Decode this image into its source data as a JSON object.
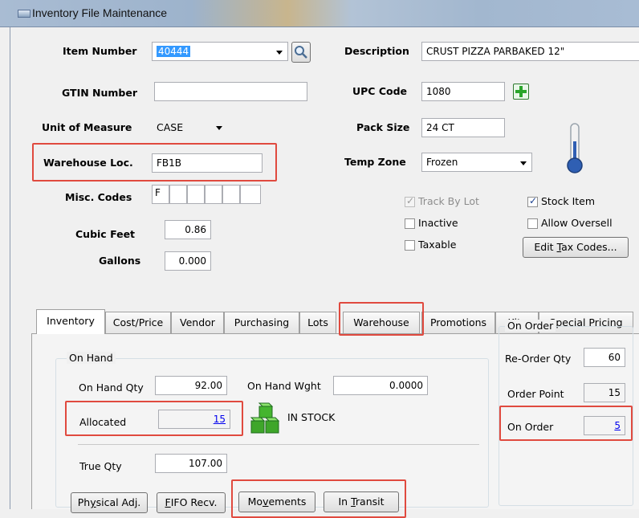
{
  "window": {
    "title": "Inventory File Maintenance"
  },
  "header": {
    "item_number": {
      "label": "Item Number",
      "value": "40444"
    },
    "gtin_number": {
      "label": "GTIN Number",
      "value": ""
    },
    "unit_of_measure": {
      "label": "Unit of Measure",
      "value": "CASE"
    },
    "warehouse_loc": {
      "label": "Warehouse Loc.",
      "value": "FB1B"
    },
    "misc_codes": {
      "label": "Misc. Codes",
      "values": [
        "F",
        "",
        "",
        "",
        "",
        ""
      ]
    },
    "cubic_feet": {
      "label": "Cubic Feet",
      "value": "0.86"
    },
    "gallons": {
      "label": "Gallons",
      "value": "0.000"
    },
    "description": {
      "label": "Description",
      "value": "CRUST PIZZA PARBAKED 12\""
    },
    "upc_code": {
      "label": "UPC Code",
      "value": "1080"
    },
    "pack_size": {
      "label": "Pack Size",
      "value": "24 CT"
    },
    "temp_zone": {
      "label": "Temp Zone",
      "value": "Frozen"
    }
  },
  "checkboxes": {
    "track_by_lot": {
      "label": "Track By Lot",
      "checked": true,
      "enabled": false
    },
    "stock_item": {
      "label": "Stock Item",
      "checked": true
    },
    "inactive": {
      "label": "Inactive",
      "checked": false
    },
    "allow_oversell": {
      "label": "Allow Oversell",
      "checked": false
    },
    "taxable": {
      "label": "Taxable",
      "checked": false
    }
  },
  "buttons": {
    "edit_tax_codes": {
      "pre": "Edit ",
      "accel": "T",
      "post": "ax Codes..."
    },
    "physical_adj": {
      "pre": "Ph",
      "accel": "y",
      "post": "sical Adj."
    },
    "fifo_recv": {
      "pre": "",
      "accel": "F",
      "post": "IFO Recv."
    },
    "movements": {
      "pre": "Mo",
      "accel": "v",
      "post": "ements"
    },
    "in_transit": {
      "pre": "In ",
      "accel": "T",
      "post": "ransit"
    }
  },
  "tabs": [
    "Inventory",
    "Cost/Price",
    "Vendor",
    "Purchasing",
    "Lots",
    "Warehouse",
    "Promotions",
    "Kits",
    "Special Pricing"
  ],
  "active_tab": "Inventory",
  "on_hand": {
    "title": "On Hand",
    "on_hand_qty": {
      "label": "On Hand Qty",
      "value": "92.00"
    },
    "on_hand_wght": {
      "label": "On Hand Wght",
      "value": "0.0000"
    },
    "allocated": {
      "label": "Allocated",
      "value": "15"
    },
    "stock_status": "IN STOCK",
    "true_qty": {
      "label": "True Qty",
      "value": "107.00"
    }
  },
  "on_order": {
    "title": "On Order",
    "reorder_qty": {
      "label": "Re-Order Qty",
      "value": "60"
    },
    "order_point": {
      "label": "Order Point",
      "value": "15"
    },
    "on_order": {
      "label": "On Order",
      "value": "5"
    }
  },
  "colors": {
    "highlight_box": "#e04a3f",
    "link": "#0000ee",
    "selection": "#3399ff",
    "add_icon": "#2aa52a"
  },
  "icons": [
    "search-icon",
    "add-icon",
    "thermometer-icon",
    "stock-boxes-icon"
  ]
}
